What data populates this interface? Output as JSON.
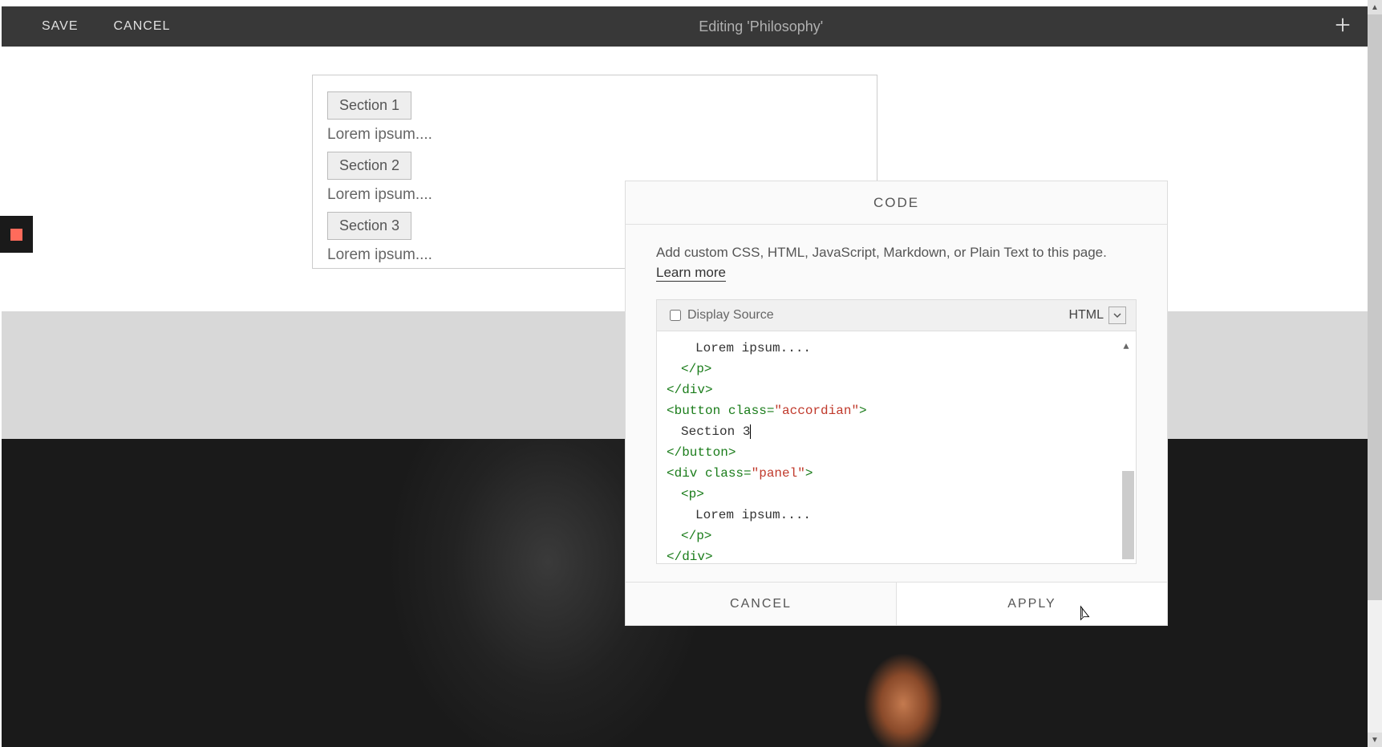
{
  "topbar": {
    "save_label": "SAVE",
    "cancel_label": "CANCEL",
    "title": "Editing 'Philosophy'"
  },
  "content": {
    "sections": [
      {
        "button": "Section 1",
        "text": "Lorem ipsum...."
      },
      {
        "button": "Section 2",
        "text": "Lorem ipsum...."
      },
      {
        "button": "Section 3",
        "text": "Lorem ipsum...."
      }
    ]
  },
  "modal": {
    "title": "CODE",
    "description": "Add custom CSS, HTML, JavaScript, Markdown, or Plain Text to this page.",
    "learn_more": "Learn more",
    "display_source_label": "Display Source",
    "language": "HTML",
    "cancel": "CANCEL",
    "apply": "APPLY",
    "code_lines": [
      {
        "indent": 2,
        "spans": [
          {
            "cls": "t-text",
            "v": "Lorem ipsum...."
          }
        ]
      },
      {
        "indent": 1,
        "spans": [
          {
            "cls": "t-tag",
            "v": "</p>"
          }
        ]
      },
      {
        "indent": 0,
        "spans": [
          {
            "cls": "t-tag",
            "v": "</div>"
          }
        ]
      },
      {
        "indent": 0,
        "spans": [
          {
            "cls": "t-tag",
            "v": "<button "
          },
          {
            "cls": "t-attr",
            "v": "class="
          },
          {
            "cls": "t-str",
            "v": "\"accordian\""
          },
          {
            "cls": "t-tag",
            "v": ">"
          }
        ]
      },
      {
        "indent": 1,
        "spans": [
          {
            "cls": "t-text",
            "v": "Section 3"
          }
        ],
        "caret": true
      },
      {
        "indent": 0,
        "spans": [
          {
            "cls": "t-tag",
            "v": "</button>"
          }
        ]
      },
      {
        "indent": 0,
        "spans": [
          {
            "cls": "t-tag",
            "v": "<div "
          },
          {
            "cls": "t-attr",
            "v": "class="
          },
          {
            "cls": "t-str",
            "v": "\"panel\""
          },
          {
            "cls": "t-tag",
            "v": ">"
          }
        ]
      },
      {
        "indent": 1,
        "spans": [
          {
            "cls": "t-tag",
            "v": "<p>"
          }
        ]
      },
      {
        "indent": 2,
        "spans": [
          {
            "cls": "t-text",
            "v": "Lorem ipsum...."
          }
        ]
      },
      {
        "indent": 1,
        "spans": [
          {
            "cls": "t-tag",
            "v": "</p>"
          }
        ]
      },
      {
        "indent": 0,
        "spans": [
          {
            "cls": "t-tag",
            "v": "</div>"
          }
        ]
      }
    ]
  }
}
